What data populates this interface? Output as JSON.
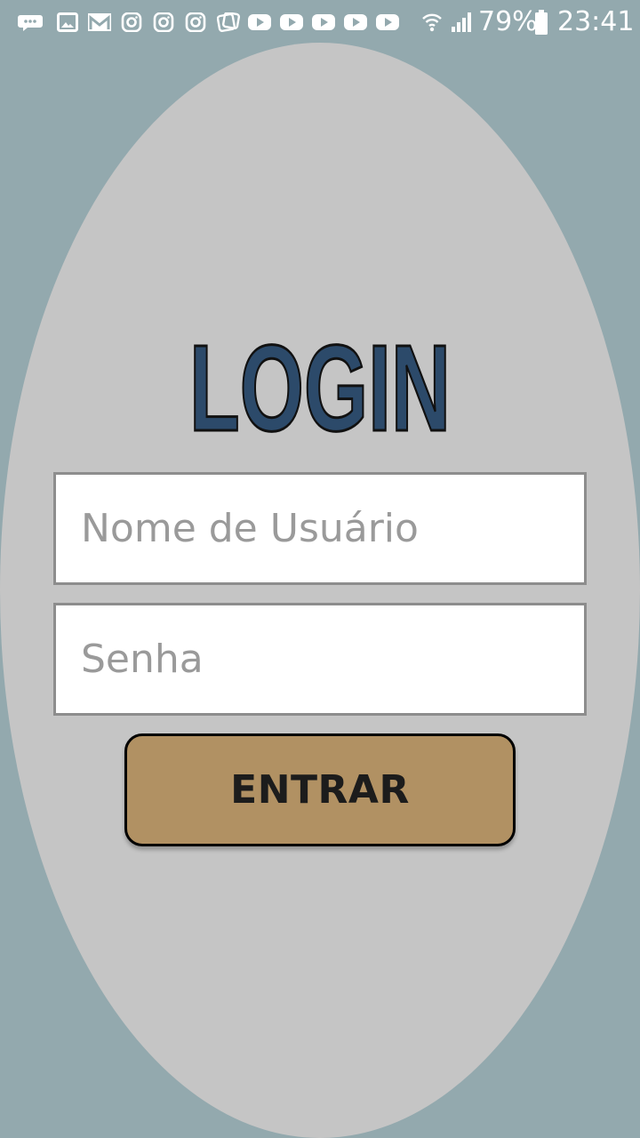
{
  "status_bar": {
    "battery_percent": "79%",
    "time": "23:41",
    "notification_icons": [
      "messages-icon",
      "gallery-icon",
      "gmail-icon",
      "instagram-icon",
      "instagram-icon",
      "instagram-icon",
      "app-icon",
      "youtube-icon",
      "youtube-icon",
      "youtube-icon",
      "youtube-icon",
      "youtube-icon"
    ],
    "system_icons": [
      "wifi-icon",
      "signal-icon",
      "battery-icon"
    ]
  },
  "login": {
    "title": "LOGIN",
    "title_color": "#2c4a6a",
    "username_placeholder": "Nome de Usuário",
    "password_placeholder": "Senha",
    "submit_label": "ENTRAR"
  },
  "colors": {
    "background": "#93a9ae",
    "oval": "#c5c5c5",
    "button": "#b19163"
  }
}
